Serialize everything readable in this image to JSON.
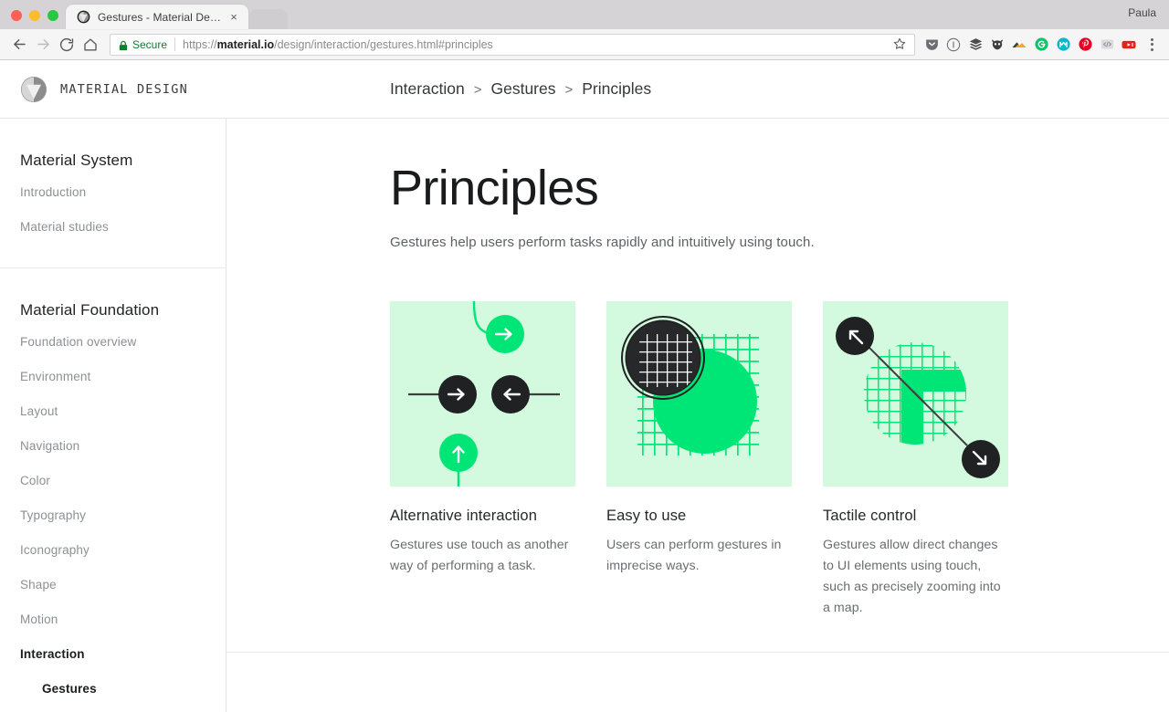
{
  "browser": {
    "profile_name": "Paula",
    "tab": {
      "title": "Gestures - Material Design",
      "favicon": "material-design-logo-icon",
      "close_icon": "×"
    },
    "nav": {
      "back_icon": "back-arrow-icon",
      "forward_icon": "forward-arrow-icon",
      "reload_icon": "reload-icon",
      "home_icon": "home-icon"
    },
    "omnibox": {
      "security_icon": "lock-icon",
      "security_label": "Secure",
      "url_scheme": "https://",
      "url_domain": "material.io",
      "url_path": "/design/interaction/gestures.html#principles",
      "url_full": "https://material.io/design/interaction/gestures.html#principles",
      "bookmark_icon": "star-icon"
    },
    "extensions": [
      {
        "name": "pocket-icon",
        "color": "#6b6e72"
      },
      {
        "name": "info-circle-icon",
        "color": "#6b6e72"
      },
      {
        "name": "layers-stack-icon",
        "color": "#4a4d50"
      },
      {
        "name": "owl-icon",
        "color": "#3b3e41"
      },
      {
        "name": "mountain-peak-icon",
        "color": "#f5a623"
      },
      {
        "name": "grammarly-icon",
        "color": "#15c26b"
      },
      {
        "name": "mendeley-icon",
        "color": "#11b5c9"
      },
      {
        "name": "pinterest-icon",
        "color": "#e60023"
      },
      {
        "name": "code-brackets-icon",
        "color": "#9aa0a6"
      },
      {
        "name": "youtube-icon",
        "color": "#e62117"
      }
    ],
    "menu_icon": "kebab-menu-icon"
  },
  "site": {
    "logo_icon": "material-design-logo-icon",
    "brand": "MATERIAL DESIGN",
    "breadcrumb": [
      "Interaction",
      "Gestures",
      "Principles"
    ],
    "breadcrumb_separator": ">"
  },
  "sidebar": {
    "groups": [
      {
        "title": "Material System",
        "items": [
          {
            "label": "Introduction",
            "state": "normal"
          },
          {
            "label": "Material studies",
            "state": "normal"
          }
        ]
      },
      {
        "title": "Material Foundation",
        "items": [
          {
            "label": "Foundation overview",
            "state": "normal"
          },
          {
            "label": "Environment",
            "state": "normal"
          },
          {
            "label": "Layout",
            "state": "normal"
          },
          {
            "label": "Navigation",
            "state": "normal"
          },
          {
            "label": "Color",
            "state": "normal"
          },
          {
            "label": "Typography",
            "state": "normal"
          },
          {
            "label": "Iconography",
            "state": "normal"
          },
          {
            "label": "Shape",
            "state": "normal"
          },
          {
            "label": "Motion",
            "state": "normal"
          },
          {
            "label": "Interaction",
            "state": "active"
          },
          {
            "label": "Gestures",
            "state": "sub-active"
          }
        ]
      }
    ]
  },
  "main": {
    "title": "Principles",
    "subtitle": "Gestures help users perform tasks rapidly and intuitively using touch.",
    "cards": [
      {
        "art": "swipe-arrows-illustration",
        "heading": "Alternative interaction",
        "body": "Gestures use touch as another way of performing a task."
      },
      {
        "art": "magnifier-grid-circle-illustration",
        "heading": "Easy to use",
        "body": "Users can perform gestures in imprecise ways."
      },
      {
        "art": "pinch-zoom-map-illustration",
        "heading": "Tactile control",
        "body": "Gestures allow direct changes to UI elements using touch, such as precisely zooming into a map."
      }
    ]
  },
  "colors": {
    "art_background": "#d3fade",
    "accent_green": "#00e676",
    "dark": "#1f2123",
    "secure_green": "#0b7f2e",
    "muted_text": "#8d9094",
    "body_text": "#6a6e72"
  }
}
